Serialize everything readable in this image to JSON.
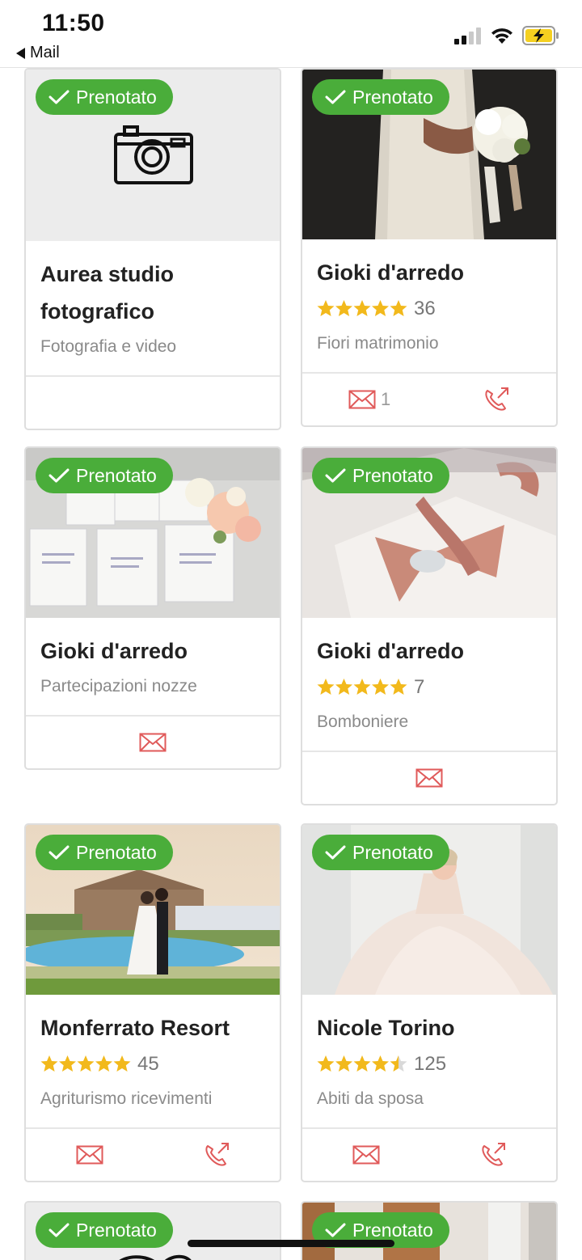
{
  "status": {
    "time": "11:50",
    "back_label": "Mail"
  },
  "colors": {
    "accent": "#4aad3a",
    "icon_red": "#e05a5a",
    "star": "#f2b91c"
  },
  "badge_label": "Prenotato",
  "cards": [
    {
      "name": "Aurea studio fotografico",
      "category": "Fotografia e video",
      "rating": null,
      "reviews": null,
      "image": "camera-placeholder-icon",
      "actions": []
    },
    {
      "name": "Gioki d'arredo",
      "category": "Fiori matrimonio",
      "rating": 5,
      "reviews": "36",
      "image": "bride-bouquet",
      "actions": [
        "mail",
        "phone"
      ],
      "mail_count": "1"
    },
    {
      "name": "Gioki d'arredo",
      "category": "Partecipazioni nozze",
      "rating": null,
      "reviews": null,
      "image": "invitations-flowers",
      "actions": [
        "mail"
      ]
    },
    {
      "name": "Gioki d'arredo",
      "category": "Bomboniere",
      "rating": 5,
      "reviews": "7",
      "image": "favors-ribbon",
      "actions": [
        "mail"
      ]
    },
    {
      "name": "Monferrato Resort",
      "category": "Agriturismo ricevimenti",
      "rating": 5,
      "reviews": "45",
      "image": "couple-pool",
      "actions": [
        "mail",
        "phone"
      ]
    },
    {
      "name": "Nicole Torino",
      "category": "Abiti da sposa",
      "rating": 4.5,
      "reviews": "125",
      "image": "bride-dress",
      "actions": [
        "mail",
        "phone"
      ]
    },
    {
      "name": "",
      "category": "",
      "rating": null,
      "reviews": null,
      "image": "placeholder-partial",
      "actions": []
    },
    {
      "name": "",
      "category": "",
      "rating": null,
      "reviews": null,
      "image": "interior-partial",
      "actions": []
    }
  ]
}
